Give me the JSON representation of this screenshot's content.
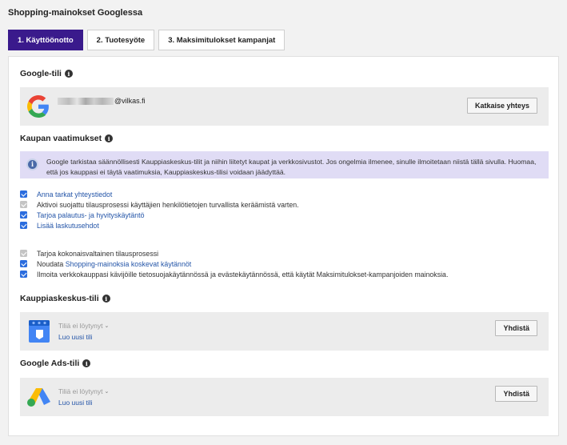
{
  "page": {
    "title": "Shopping-mainokset Googlessa"
  },
  "tabs": [
    {
      "label": "1. Käyttöönotto",
      "active": true
    },
    {
      "label": "2. Tuotesyöte",
      "active": false
    },
    {
      "label": "3. Maksimitulokset kampanjat",
      "active": false
    }
  ],
  "google_account": {
    "title": "Google-tili",
    "email_domain": "@vilkas.fi",
    "disconnect_label": "Katkaise yhteys"
  },
  "requirements": {
    "title": "Kaupan vaatimukset",
    "notice": "Google tarkistaa säännöllisesti Kauppiaskeskus-tilit ja niihin liitetyt kaupat ja verkkosivustot. Jos ongelmia ilmenee, sinulle ilmoitetaan niistä tällä sivulla. Huomaa, että jos kauppasi ei täytä vaatimuksia, Kauppiaskeskus-tilisi voidaan jäädyttää.",
    "group1": [
      {
        "text": "Anna tarkat yhteystiedot",
        "link": true,
        "disabled": false
      },
      {
        "text": "Aktivoi suojattu tilausprosessi käyttäjien henkilötietojen turvallista keräämistä varten.",
        "link": false,
        "disabled": true
      },
      {
        "text": "Tarjoa palautus- ja hyvityskäytäntö",
        "link": true,
        "disabled": false
      },
      {
        "text": "Lisää laskutusehdot",
        "link": true,
        "disabled": false
      }
    ],
    "group2": {
      "item1": "Tarjoa kokonaisvaltainen tilausprosessi",
      "item2_prefix": "Noudata ",
      "item2_link": "Shopping-mainoksia koskevat käytännöt",
      "item3": "Ilmoita verkkokauppasi kävijöille tietosuojakäytännössä ja evästekäytännössä, että käytät Maksimitulokset-kampanjoiden mainoksia."
    }
  },
  "merchant_center": {
    "title": "Kauppiaskeskus-tili",
    "select_placeholder": "Tiliä ei löytynyt",
    "create_link": "Luo uusi tili",
    "connect_label": "Yhdistä"
  },
  "google_ads": {
    "title": "Google Ads-tili",
    "select_placeholder": "Tiliä ei löytynyt",
    "create_link": "Luo uusi tili",
    "connect_label": "Yhdistä"
  },
  "icons": {
    "info": "info-icon",
    "google": "google-logo-icon",
    "merchant_center": "merchant-center-icon",
    "google_ads": "google-ads-icon"
  },
  "colors": {
    "active_tab": "#3a1a8c",
    "checkbox": "#2b6dde",
    "link": "#2455a8",
    "notice_bg": "#e0dcf5"
  }
}
